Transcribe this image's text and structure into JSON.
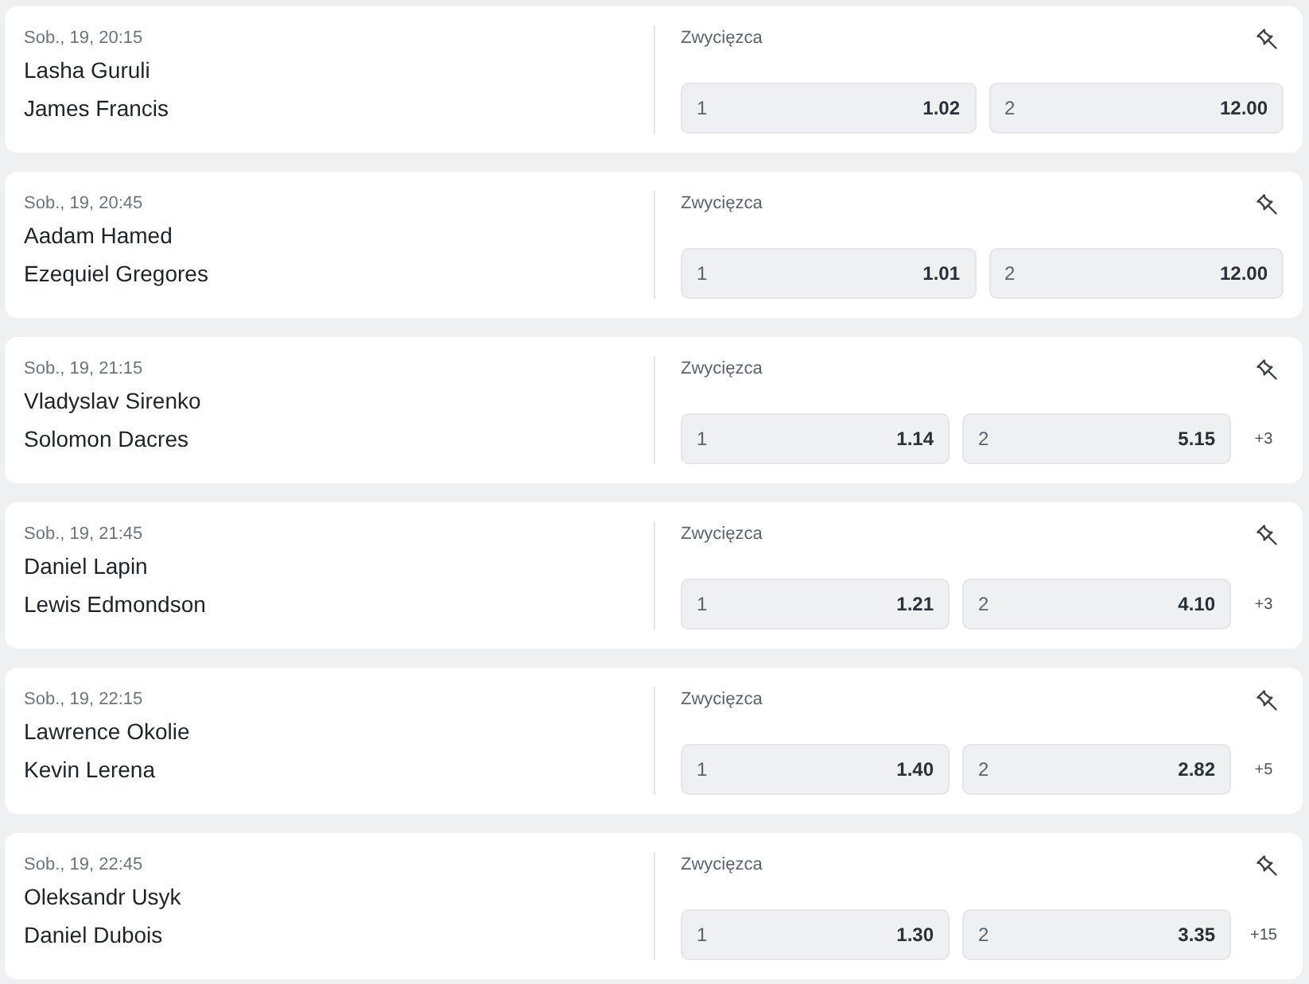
{
  "events": [
    {
      "time": "Sob., 19, 20:15",
      "competitors": [
        "Lasha Guruli",
        "James Francis"
      ],
      "market": "Zwycięzca",
      "odds": [
        {
          "label": "1",
          "price": "1.02"
        },
        {
          "label": "2",
          "price": "12.00"
        }
      ]
    },
    {
      "time": "Sob., 19, 20:45",
      "competitors": [
        "Aadam Hamed",
        "Ezequiel Gregores"
      ],
      "market": "Zwycięzca",
      "odds": [
        {
          "label": "1",
          "price": "1.01"
        },
        {
          "label": "2",
          "price": "12.00"
        }
      ]
    },
    {
      "time": "Sob., 19, 21:15",
      "competitors": [
        "Vladyslav Sirenko",
        "Solomon Dacres"
      ],
      "market": "Zwycięzca",
      "odds": [
        {
          "label": "1",
          "price": "1.14"
        },
        {
          "label": "2",
          "price": "5.15"
        }
      ],
      "more_markets": "+3"
    },
    {
      "time": "Sob., 19, 21:45",
      "competitors": [
        "Daniel Lapin",
        "Lewis Edmondson"
      ],
      "market": "Zwycięzca",
      "odds": [
        {
          "label": "1",
          "price": "1.21"
        },
        {
          "label": "2",
          "price": "4.10"
        }
      ],
      "more_markets": "+3"
    },
    {
      "time": "Sob., 19, 22:15",
      "competitors": [
        "Lawrence Okolie",
        "Kevin Lerena"
      ],
      "market": "Zwycięzca",
      "odds": [
        {
          "label": "1",
          "price": "1.40"
        },
        {
          "label": "2",
          "price": "2.82"
        }
      ],
      "more_markets": "+5"
    },
    {
      "time": "Sob., 19, 22:45",
      "competitors": [
        "Oleksandr Usyk",
        "Daniel Dubois"
      ],
      "market": "Zwycięzca",
      "odds": [
        {
          "label": "1",
          "price": "1.30"
        },
        {
          "label": "2",
          "price": "3.35"
        }
      ],
      "more_markets": "+15"
    }
  ]
}
